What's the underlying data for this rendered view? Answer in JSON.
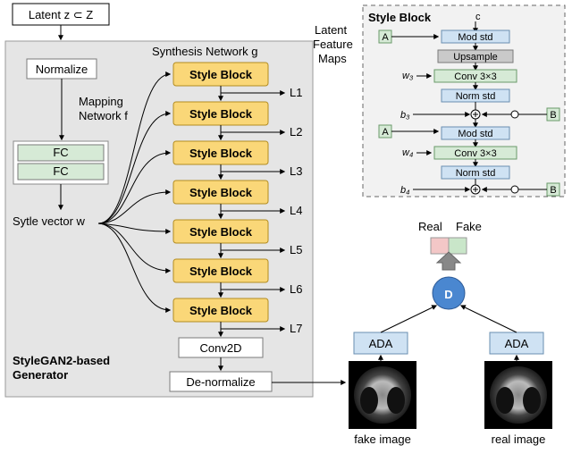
{
  "latent_box": "Latent z ⊂ Z",
  "normalize": "Normalize",
  "mapping_network": "Mapping\nNetwork f",
  "fc1": "FC",
  "fc2": "FC",
  "style_vector": "Sytle vector w",
  "synthesis_network": "Synthesis Network g",
  "style_blocks": [
    "Style Block",
    "Style Block",
    "Style Block",
    "Style Block",
    "Style Block",
    "Style Block",
    "Style Block"
  ],
  "latent_maps_label": "Latent\nFeature\nMaps",
  "L_labels": [
    "L1",
    "L2",
    "L3",
    "L4",
    "L5",
    "L6",
    "L7"
  ],
  "conv2d": "Conv2D",
  "denorm": "De-normalize",
  "generator_label": "StyleGAN2-based\nGenerator",
  "style_block_detail": {
    "title": "Style Block",
    "c": "c",
    "a": "A",
    "mod1": "Mod std",
    "upsample": "Upsample",
    "w3": "w₃",
    "conv1": "Conv 3×3",
    "norm1": "Norm std",
    "b3": "b₃",
    "mod2": "Mod std",
    "w4": "w₄",
    "conv2": "Conv 3×3",
    "norm2": "Norm std",
    "b4": "b₄",
    "b": "B"
  },
  "discriminator": {
    "real": "Real",
    "fake": "Fake",
    "d": "D",
    "ada1": "ADA",
    "ada2": "ADA",
    "fake_image": "fake image",
    "real_image": "real image"
  }
}
